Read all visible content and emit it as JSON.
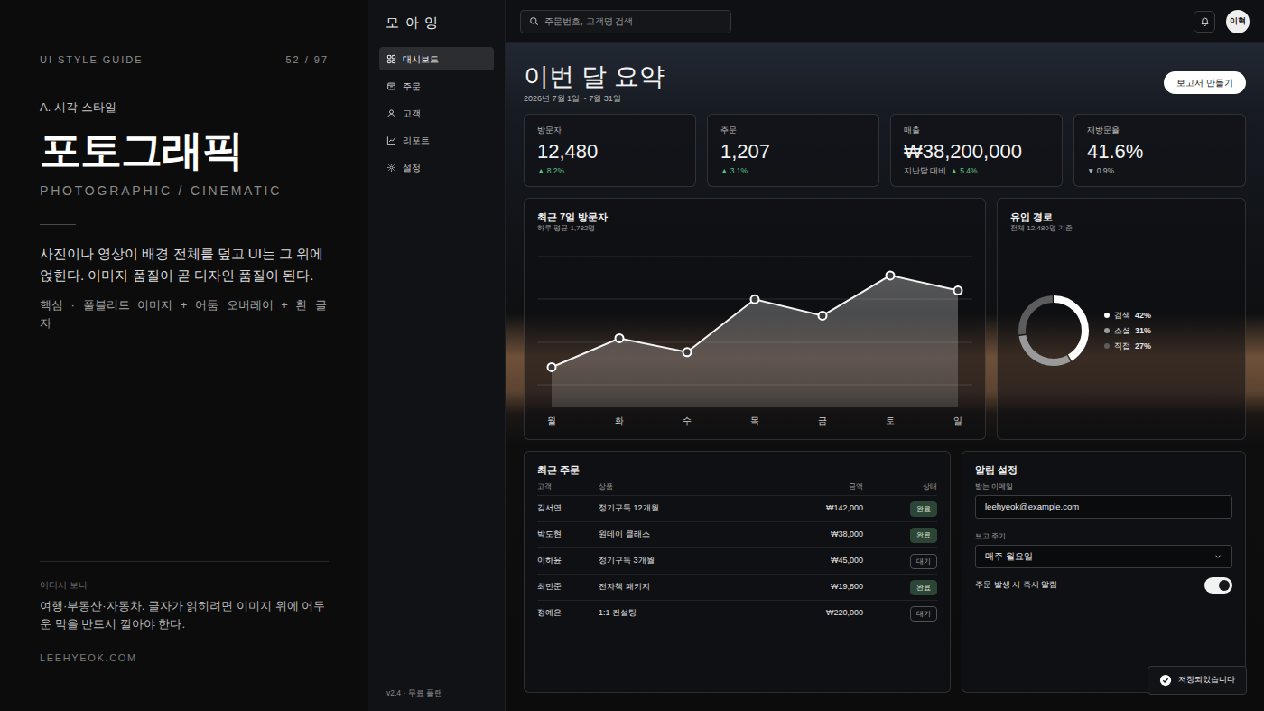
{
  "guide": {
    "header": "UI STYLE GUIDE",
    "page": "52 / 97",
    "section": "A. 시각 스타일",
    "title": "포토그래픽",
    "subtitle": "PHOTOGRAPHIC / CINEMATIC",
    "description": "사진이나 영상이 배경 전체를 덮고 UI는 그 위에 얹힌다. 이미지 품질이 곧 디자인 품질이 된다.",
    "core": "핵심 · 풀블리드 이미지 + 어둠 오버레이 + 흰 글자",
    "where_label": "어디서 보나",
    "where_text": "여행·부동산·자동차. 글자가 읽히려면 이미지 위에 어두운 막을 반드시 깔아야 한다.",
    "site": "LEEHYEOK.COM"
  },
  "app": {
    "logo": "모 아 잉",
    "sidebar": {
      "items": [
        {
          "label": "대시보드",
          "selected": true
        },
        {
          "label": "주문",
          "selected": false
        },
        {
          "label": "고객",
          "selected": false
        },
        {
          "label": "리포트",
          "selected": false
        },
        {
          "label": "설정",
          "selected": false
        }
      ],
      "footer": "v2.4 · 무료 플랜"
    },
    "search": {
      "placeholder": "주문번호, 고객명 검색"
    },
    "avatar": "이혁",
    "header": {
      "title": "이번 달 요약",
      "period": "2026년 7월 1일 ~ 7월 31일",
      "button": "보고서 만들기"
    },
    "stats": [
      {
        "label": "방문자",
        "value": "12,480",
        "change": "▲ 8.2%",
        "kind": "up"
      },
      {
        "label": "주문",
        "value": "1,207",
        "change": "▲ 3.1%",
        "kind": "up"
      },
      {
        "label": "매출",
        "value": "₩38,200,000",
        "note": "지난달 대비",
        "change": "▲ 5.4%",
        "kind": "up"
      },
      {
        "label": "재방문율",
        "value": "41.6%",
        "change": "▼ 0.9%",
        "kind": "down"
      }
    ],
    "visitors": {
      "title": "최근 7일 방문자",
      "subtitle": "하루 평균 1,782명",
      "days": [
        "월",
        "화",
        "수",
        "목",
        "금",
        "토",
        "일"
      ],
      "values": [
        1420,
        1650,
        1540,
        1960,
        1830,
        2150,
        2030
      ]
    },
    "traffic": {
      "title": "유입 경로",
      "subtitle": "전체 12,480명 기준",
      "legend": [
        {
          "label": "검색",
          "value": "42%",
          "share": 0.42,
          "color": "#ffffff"
        },
        {
          "label": "소셜",
          "value": "31%",
          "share": 0.31,
          "color": "#9a9a9a"
        },
        {
          "label": "직접",
          "value": "27%",
          "share": 0.27,
          "color": "#5c5c5c"
        }
      ]
    },
    "orders": {
      "title": "최근 주문",
      "columns": [
        "고객",
        "상품",
        "금액",
        "상태"
      ],
      "rows": [
        {
          "customer": "김서연",
          "product": "정기구독 12개월",
          "amount": "₩142,000",
          "status": "완료",
          "kind": "done"
        },
        {
          "customer": "박도현",
          "product": "원데이 클래스",
          "amount": "₩38,000",
          "status": "완료",
          "kind": "done"
        },
        {
          "customer": "이하윤",
          "product": "정기구독 3개월",
          "amount": "₩45,000",
          "status": "대기",
          "kind": "pending"
        },
        {
          "customer": "최민준",
          "product": "전자책 패키지",
          "amount": "₩19,800",
          "status": "완료",
          "kind": "done"
        },
        {
          "customer": "정예은",
          "product": "1:1 컨설팅",
          "amount": "₩220,000",
          "status": "대기",
          "kind": "pending"
        }
      ]
    },
    "alerts": {
      "title": "알림 설정",
      "email_label": "받는 이메일",
      "email": "leehyeok@example.com",
      "cycle_label": "보고 주기",
      "cycle": "매주 월요일",
      "instant_label": "주문 발생 시 즉시 알림",
      "instant_on": true
    },
    "toast": {
      "text": "저장되었습니다"
    }
  }
}
